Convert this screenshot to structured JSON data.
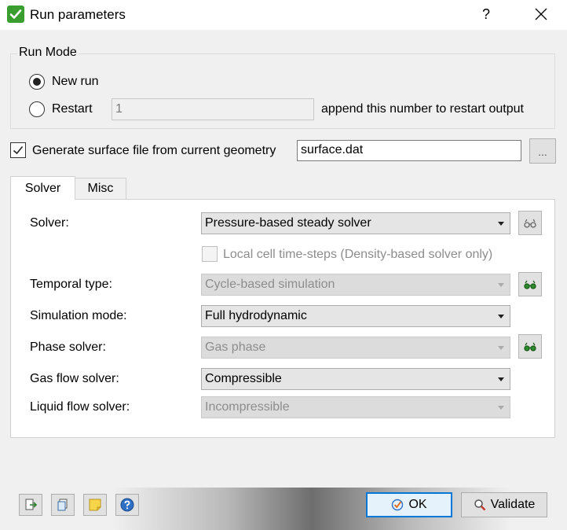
{
  "window": {
    "title": "Run parameters",
    "help_label": "?"
  },
  "run_mode": {
    "title": "Run Mode",
    "new_run_label": "New run",
    "new_run_selected": true,
    "restart_label": "Restart",
    "restart_value": "1",
    "restart_hint": "append this number to restart output"
  },
  "surface": {
    "checked": true,
    "label": "Generate surface file from current geometry",
    "filename": "surface.dat",
    "browse_label": "..."
  },
  "tabs": [
    {
      "label": "Solver",
      "active": true
    },
    {
      "label": "Misc",
      "active": false
    }
  ],
  "solver_tab": {
    "solver_label": "Solver:",
    "solver_value": "Pressure-based steady solver",
    "local_timesteps_label": "Local cell time-steps (Density-based solver only)",
    "local_timesteps_checked": false,
    "temporal_label": "Temporal type:",
    "temporal_value": "Cycle-based simulation",
    "simulation_label": "Simulation mode:",
    "simulation_value": "Full hydrodynamic",
    "phase_label": "Phase solver:",
    "phase_value": "Gas phase",
    "gas_flow_label": "Gas flow solver:",
    "gas_flow_value": "Compressible",
    "liquid_flow_label": "Liquid flow solver:",
    "liquid_flow_value": "Incompressible"
  },
  "footer": {
    "ok_label": "OK",
    "validate_label": "Validate"
  },
  "colors": {
    "accent": "#0078d7",
    "check_green": "#3a9d2f"
  }
}
